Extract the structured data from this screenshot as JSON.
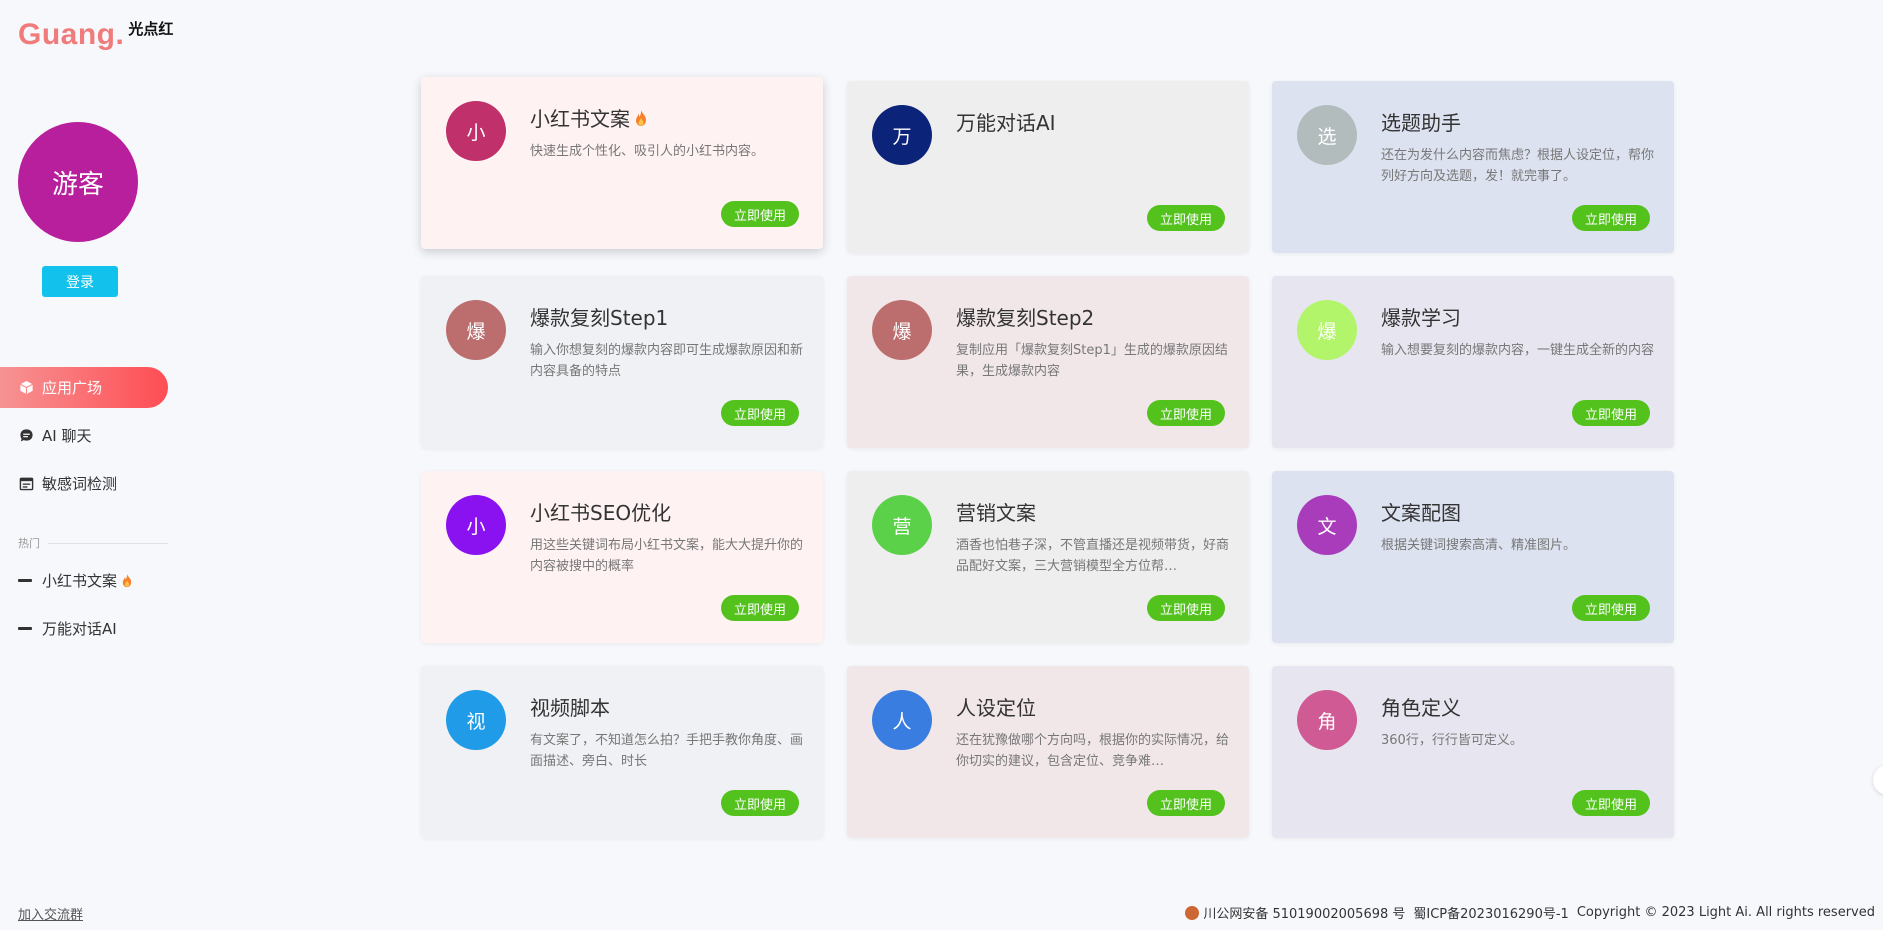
{
  "brand": {
    "name": "Guang.",
    "subtitle": "光点红"
  },
  "user": {
    "avatar_text": "游客",
    "login_label": "登录"
  },
  "nav": [
    {
      "label": "应用广场",
      "icon": "cube-icon",
      "active": true
    },
    {
      "label": "AI 聊天",
      "icon": "chat-icon",
      "active": false
    },
    {
      "label": "敏感词检测",
      "icon": "calendar-icon",
      "active": false
    }
  ],
  "hot": {
    "section_label": "热门",
    "items": [
      {
        "label": "小红书文案",
        "fire": true
      },
      {
        "label": "万能对话AI",
        "fire": false
      }
    ]
  },
  "join_label": "加入交流群",
  "use_label": "立即使用",
  "cards": [
    {
      "avatar": "小",
      "title": "小红书文案",
      "fire": true,
      "desc": "快速生成个性化、吸引人的小红书内容。",
      "bg": "#fff2f2",
      "avatar_bg": "#c0306a"
    },
    {
      "avatar": "万",
      "title": "万能对话AI",
      "fire": false,
      "desc": "",
      "bg": "#eeeeee",
      "avatar_bg": "#0b2479"
    },
    {
      "avatar": "选",
      "title": "选题助手",
      "fire": false,
      "desc": "还在为发什么内容而焦虑？根据人设定位，帮你列好方向及选题，发！就完事了。",
      "bg": "#dde2f0",
      "avatar_bg": "#b3bcbc"
    },
    {
      "avatar": "爆",
      "title": "爆款复刻Step1",
      "fire": false,
      "desc": "输入你想复刻的爆款内容即可生成爆款原因和新内容具备的特点",
      "bg": "#eff1f5",
      "avatar_bg": "#bc6e6e"
    },
    {
      "avatar": "爆",
      "title": "爆款复刻Step2",
      "fire": false,
      "desc": "复制应用「爆款复刻Step1」生成的爆款原因结果，生成爆款内容",
      "bg": "#f1e7e9",
      "avatar_bg": "#bc6e6e"
    },
    {
      "avatar": "爆",
      "title": "爆款学习",
      "fire": false,
      "desc": "输入想要复刻的爆款内容，一键生成全新的内容",
      "bg": "#e7e6f0",
      "avatar_bg": "#b2f56a"
    },
    {
      "avatar": "小",
      "title": "小红书SEO优化",
      "fire": false,
      "desc": "用这些关键词布局小红书文案，能大大提升你的内容被搜中的概率",
      "bg": "#fff2f2",
      "avatar_bg": "#8a12f0"
    },
    {
      "avatar": "营",
      "title": "营销文案",
      "fire": false,
      "desc": "酒香也怕巷子深，不管直播还是视频带货，好商品配好文案，三大营销模型全方位帮…",
      "bg": "#eeeeee",
      "avatar_bg": "#5bd14a"
    },
    {
      "avatar": "文",
      "title": "文案配图",
      "fire": false,
      "desc": "根据关键词搜索高清、精准图片。",
      "bg": "#dde2f0",
      "avatar_bg": "#a83cba"
    },
    {
      "avatar": "视",
      "title": "视频脚本",
      "fire": false,
      "desc": "有文案了，不知道怎么拍？手把手教你角度、画面描述、旁白、时长",
      "bg": "#eff1f5",
      "avatar_bg": "#1f9be8"
    },
    {
      "avatar": "人",
      "title": "人设定位",
      "fire": false,
      "desc": "还在犹豫做哪个方向吗，根据你的实际情况，给你切实的建议，包含定位、竞争难…",
      "bg": "#f1e7e9",
      "avatar_bg": "#3a7de0"
    },
    {
      "avatar": "角",
      "title": "角色定义",
      "fire": false,
      "desc": "360行，行行皆可定义。",
      "bg": "#e7e6f0",
      "avatar_bg": "#d05a93"
    }
  ],
  "footer": {
    "police": "川公网安备 51019002005698 号",
    "icp": "蜀ICP备2023016290号-1",
    "copyright": "Copyright © 2023 Light Ai. All rights reserved"
  }
}
